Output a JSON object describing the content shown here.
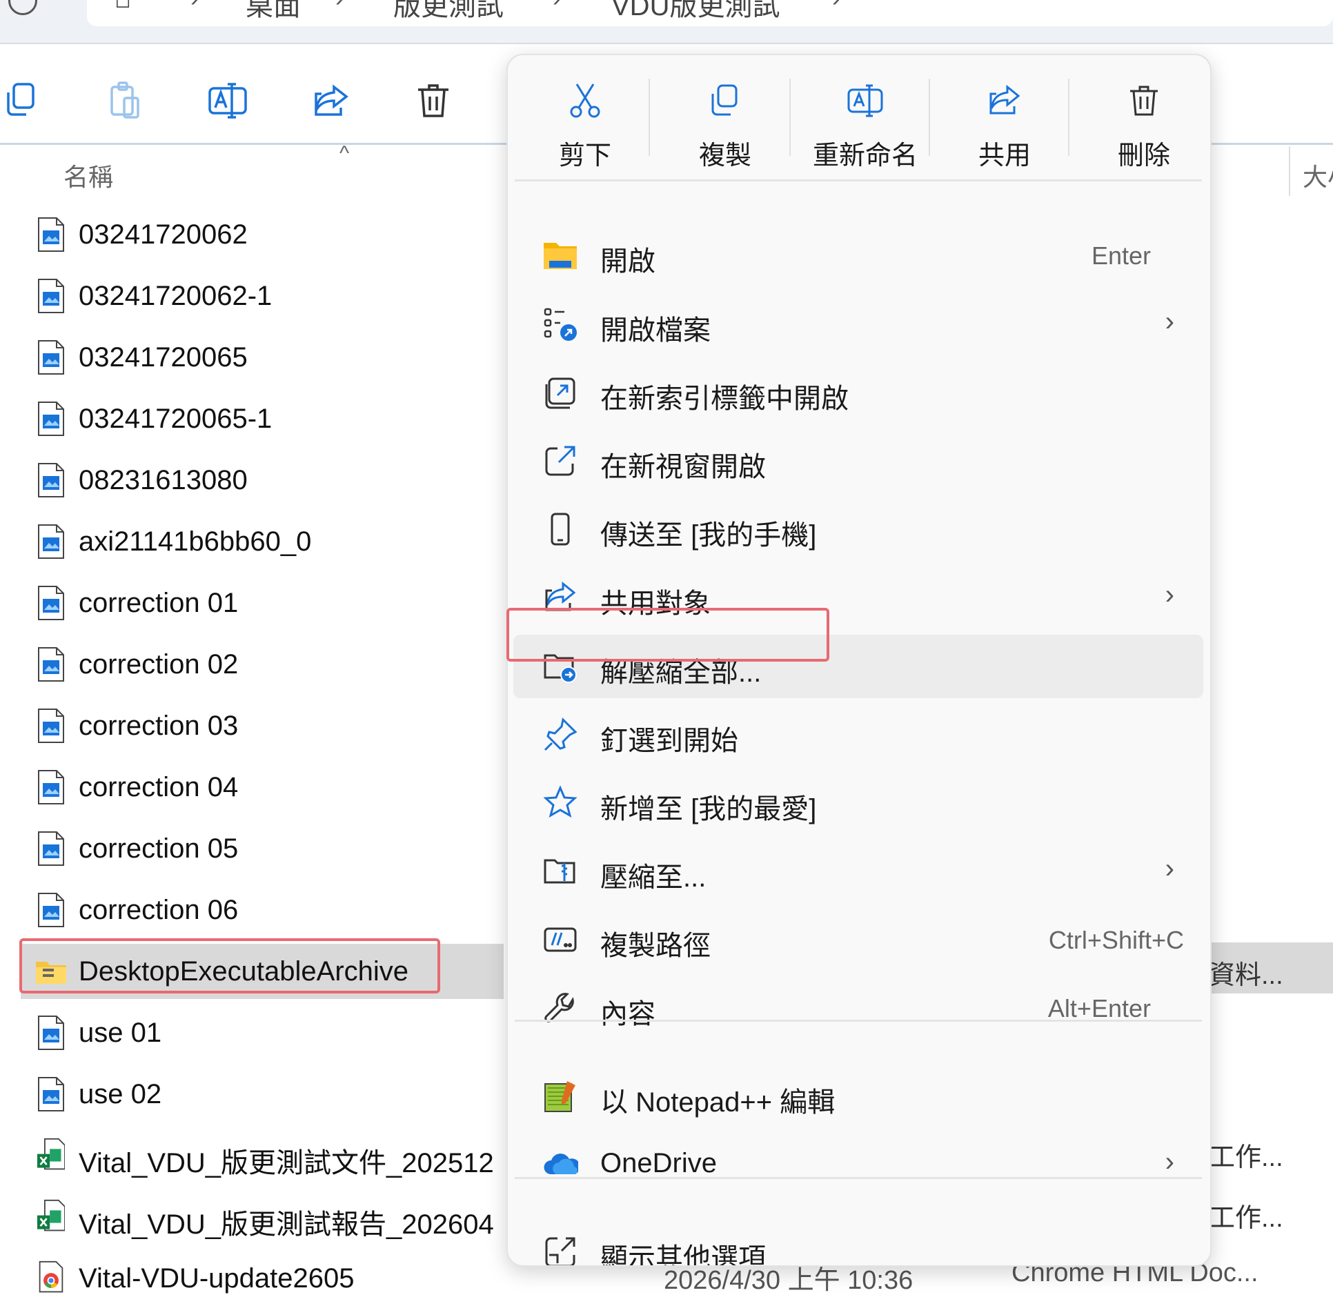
{
  "address_bar": {
    "segments": [
      "桌面",
      "版更測試",
      "VDU版更測試"
    ]
  },
  "column_headers": {
    "name": "名稱",
    "size_partial": "大小"
  },
  "files": [
    {
      "name": "03241720062",
      "icon": "image-file-icon"
    },
    {
      "name": "03241720062-1",
      "icon": "image-file-icon"
    },
    {
      "name": "03241720065",
      "icon": "image-file-icon"
    },
    {
      "name": "03241720065-1",
      "icon": "image-file-icon"
    },
    {
      "name": "08231613080",
      "icon": "image-file-icon"
    },
    {
      "name": "axi21141b6bb60_0",
      "icon": "image-file-icon"
    },
    {
      "name": "correction 01",
      "icon": "image-file-icon"
    },
    {
      "name": "correction 02",
      "icon": "image-file-icon"
    },
    {
      "name": "correction 03",
      "icon": "image-file-icon"
    },
    {
      "name": "correction 04",
      "icon": "image-file-icon"
    },
    {
      "name": "correction 05",
      "icon": "image-file-icon"
    },
    {
      "name": "correction 06",
      "icon": "image-file-icon"
    },
    {
      "name": "DesktopExecutableArchive",
      "icon": "zip-folder-icon",
      "selected": true
    },
    {
      "name": "use 01",
      "icon": "image-file-icon"
    },
    {
      "name": "use 02",
      "icon": "image-file-icon"
    },
    {
      "name": "Vital_VDU_版更測試文件_202512",
      "icon": "excel-file-icon"
    },
    {
      "name": "Vital_VDU_版更測試報告_202604",
      "icon": "excel-file-icon"
    },
    {
      "name": "Vital-VDU-update2605",
      "icon": "chrome-html-icon"
    }
  ],
  "right_column": {
    "archive_type": "資料...",
    "excel_type_1": "工作...",
    "excel_type_2": "工作...",
    "last_date": "2026/4/30 上午 10:36",
    "last_type": "Chrome HTML Doc..."
  },
  "context_menu": {
    "quick_actions": [
      {
        "label": "剪下",
        "icon": "scissors-icon"
      },
      {
        "label": "複製",
        "icon": "copy-icon"
      },
      {
        "label": "重新命名",
        "icon": "rename-icon"
      },
      {
        "label": "共用",
        "icon": "share-icon"
      },
      {
        "label": "刪除",
        "icon": "trash-icon"
      }
    ],
    "items": [
      {
        "label": "開啟",
        "shortcut": "Enter",
        "icon": "folder-open-icon"
      },
      {
        "label": "開啟檔案",
        "submenu": true,
        "icon": "open-with-icon"
      },
      {
        "label": "在新索引標籤中開啟",
        "icon": "new-tab-icon"
      },
      {
        "label": "在新視窗開啟",
        "icon": "new-window-icon"
      },
      {
        "label": "傳送至 [我的手機]",
        "icon": "phone-icon"
      },
      {
        "label": "共用對象",
        "submenu": true,
        "icon": "share-with-icon"
      },
      {
        "label": "解壓縮全部...",
        "icon": "extract-all-icon",
        "highlighted": true
      },
      {
        "label": "釘選到開始",
        "icon": "pin-icon"
      },
      {
        "label": "新增至 [我的最愛]",
        "icon": "star-icon"
      },
      {
        "label": "壓縮至...",
        "submenu": true,
        "icon": "compress-icon"
      },
      {
        "label": "複製路徑",
        "shortcut": "Ctrl+Shift+C",
        "icon": "copy-path-icon"
      },
      {
        "label": "內容",
        "shortcut": "Alt+Enter",
        "icon": "wrench-icon"
      },
      {
        "label": "以 Notepad++ 編輯",
        "icon": "notepadpp-icon"
      },
      {
        "label": "OneDrive",
        "submenu": true,
        "icon": "onedrive-icon"
      },
      {
        "label": "顯示其他選項",
        "icon": "more-options-icon"
      }
    ],
    "chevron": "›"
  },
  "colors": {
    "highlight_border": "#e86a72",
    "accent_blue": "#1a73d9",
    "selection_gray": "#d9d9d9"
  }
}
